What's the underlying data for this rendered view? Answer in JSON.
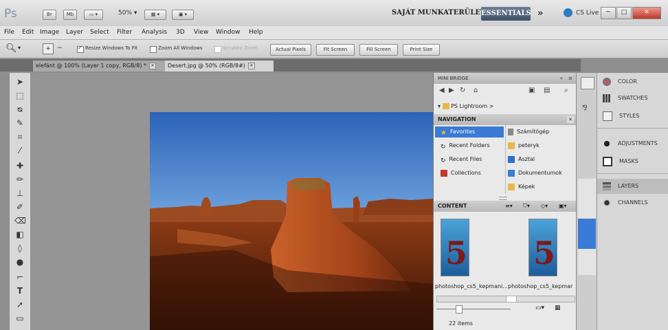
{
  "app": {
    "logo": "Ps",
    "bridge_btn": "Br",
    "minibridge_btn": "Mb",
    "zoom": "50%",
    "workspace_label": "SAJÁT MUNKATERÜLET",
    "workspace_active": "ESSENTIALS",
    "more_workspaces": "»",
    "cs_live": "CS Live",
    "window_buttons": [
      "─",
      "□",
      "✕"
    ]
  },
  "menu": [
    "File",
    "Edit",
    "Image",
    "Layer",
    "Select",
    "Filter",
    "Analysis",
    "3D",
    "View",
    "Window",
    "Help"
  ],
  "options": {
    "resize_windows": "Resize Windows To Fit",
    "zoom_all": "Zoom All Windows",
    "scrubby": "Scrubby Zoom",
    "actual_pixels": "Actual Pixels",
    "fit_screen": "Fit Screen",
    "fill_screen": "Fill Screen",
    "print_size": "Print Size"
  },
  "tabs": [
    {
      "label": "elefánt @ 100% (Layer 1 copy, RGB/8) *"
    },
    {
      "label": "Desert.jpg @ 50% (RGB/8#)"
    }
  ],
  "mini_bridge": {
    "title": "MINI BRIDGE",
    "path": "PS Lightroom >",
    "navigation_label": "NAVIGATION",
    "nav_left": [
      "Favorites",
      "Recent Folders",
      "Recent Files",
      "Collections"
    ],
    "nav_right": [
      "Számítógép",
      "peteryk",
      "Asztal",
      "Dokumentumok",
      "Képek"
    ],
    "content_label": "CONTENT",
    "thumbs": [
      "photoshop_cs5_kepmani...",
      "photoshop_cs5_kepmar"
    ],
    "item_count": "22 items"
  },
  "panels": {
    "group1": [
      "COLOR",
      "SWATCHES",
      "STYLES"
    ],
    "group2": [
      "ADJUSTMENTS",
      "MASKS"
    ],
    "group3": [
      "LAYERS",
      "CHANNELS"
    ]
  },
  "colors": {
    "accent": "#3e4f68",
    "selection": "#3b7ad6"
  }
}
